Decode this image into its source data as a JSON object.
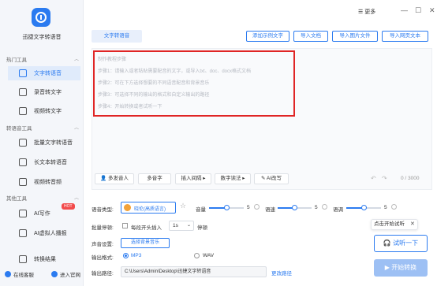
{
  "app": {
    "name": "迅捷文字转语音"
  },
  "sidebar": {
    "sections": [
      {
        "title": "热门工具"
      },
      {
        "title": "转语音工具"
      },
      {
        "title": "其他工具"
      }
    ],
    "items": [
      {
        "label": "文字转语音"
      },
      {
        "label": "录音转文字"
      },
      {
        "label": "视频转文字"
      },
      {
        "label": "批量文字转语音"
      },
      {
        "label": "长文本转语音"
      },
      {
        "label": "视频转音频"
      },
      {
        "label": "AI写作",
        "badge": "HOT"
      },
      {
        "label": "AI虚拟人播报"
      },
      {
        "label": "转换结果"
      }
    ],
    "footer": {
      "service": "在线客服",
      "website": "进入官网"
    }
  },
  "topbar": {
    "more": "更多"
  },
  "tabs": {
    "active": "文字转语音"
  },
  "actions": {
    "add_example": "添加示例文字",
    "import_doc": "导入文档",
    "import_image": "导入图片文件",
    "import_web": "导入网页文本"
  },
  "editor": {
    "placeholder_title": "制作教程步骤",
    "steps": [
      "步骤1：请输入或者粘贴需要配音的文字，或导入txt、doc、docx格式文档",
      "步骤2：可在下方选择想要的不同语音配音和背景音乐",
      "步骤3：可选择不同的输出的格式和自定义输出的路径",
      "步骤4：开始转换或者试听一下"
    ],
    "tools": {
      "multi_speaker": "多发音人",
      "polyphone": "多音字",
      "insert_pause": "插入间隔",
      "number_reading": "数字读法",
      "ai_rewrite": "AI改写"
    },
    "count": "0 / 3000"
  },
  "settings": {
    "voice_label": "语音类型:",
    "voice_value": "晓伦(高质语言)",
    "volume_label": "音量",
    "volume_value": "5",
    "volume_level": 0.5,
    "speed_label": "语速",
    "speed_value": "5",
    "speed_level": 0.5,
    "pitch_label": "语调",
    "pitch_value": "5",
    "pitch_level": 0.5,
    "batch_pause_label": "批量停顿:",
    "batch_pause_text": "每段开头插入",
    "pause_value": "1s",
    "pause_suffix": "停顿",
    "bg_music_label": "声音设置:",
    "bg_music_button": "选择背景音乐",
    "format_label": "输出格式:",
    "format_mp3": "MP3",
    "format_wav": "WAV",
    "path_label": "输出路径:",
    "path_value": "C:\\Users\\Admin\\Desktop\\迅捷文字转语音",
    "change_path": "更改路径"
  },
  "right_panel": {
    "tip": "点击开始试听",
    "try_listen": "试听一下",
    "start_convert": "开始转换"
  }
}
